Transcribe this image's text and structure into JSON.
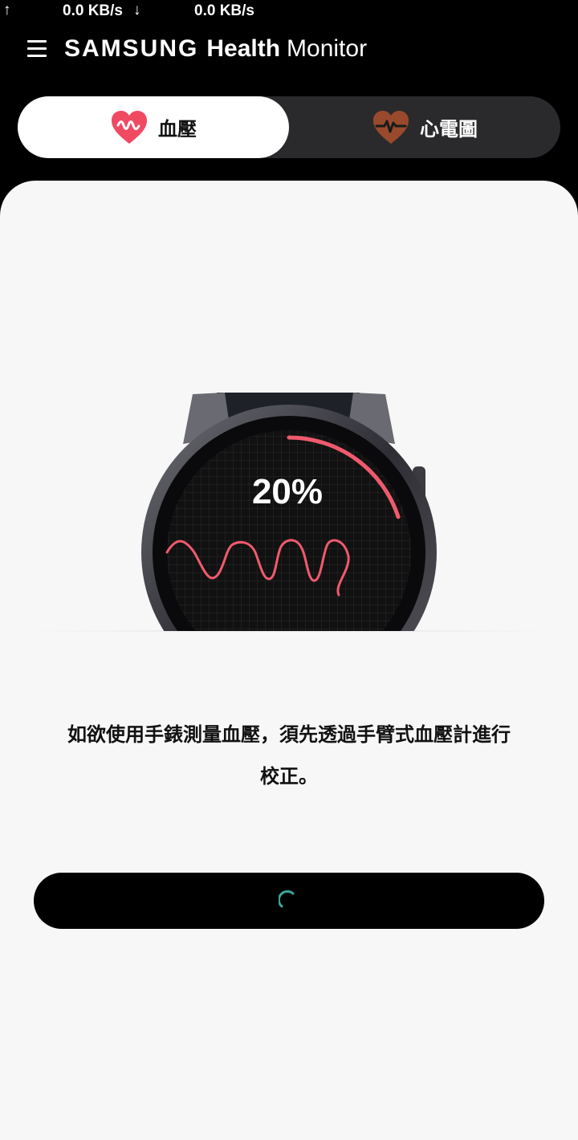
{
  "status_bar": {
    "up_arrow": "↑",
    "upload_rate": "0.0 KB/s",
    "down_arrow": "↓",
    "download_rate": "0.0 KB/s"
  },
  "header": {
    "menu_icon": "hamburger-menu-icon",
    "brand_samsung": "SAMSUNG",
    "brand_health": "Health",
    "brand_monitor": "Monitor"
  },
  "tabs": [
    {
      "label": "血壓",
      "icon": "heart-wave-icon",
      "selected": true,
      "icon_color": "#f04a63"
    },
    {
      "label": "心電圖",
      "icon": "heart-ecg-icon",
      "selected": false,
      "icon_color": "#9a4a2c"
    }
  ],
  "watch": {
    "progress_text": "20%",
    "progress_fraction": 0.2,
    "accent_color": "#f05a6e"
  },
  "main": {
    "description_line1": "如欲使用手錶測量血壓，須先透過手臂式血壓計進行",
    "description_line2": "校正。"
  },
  "button": {
    "state": "loading",
    "spinner_color": "#3aa69a"
  }
}
